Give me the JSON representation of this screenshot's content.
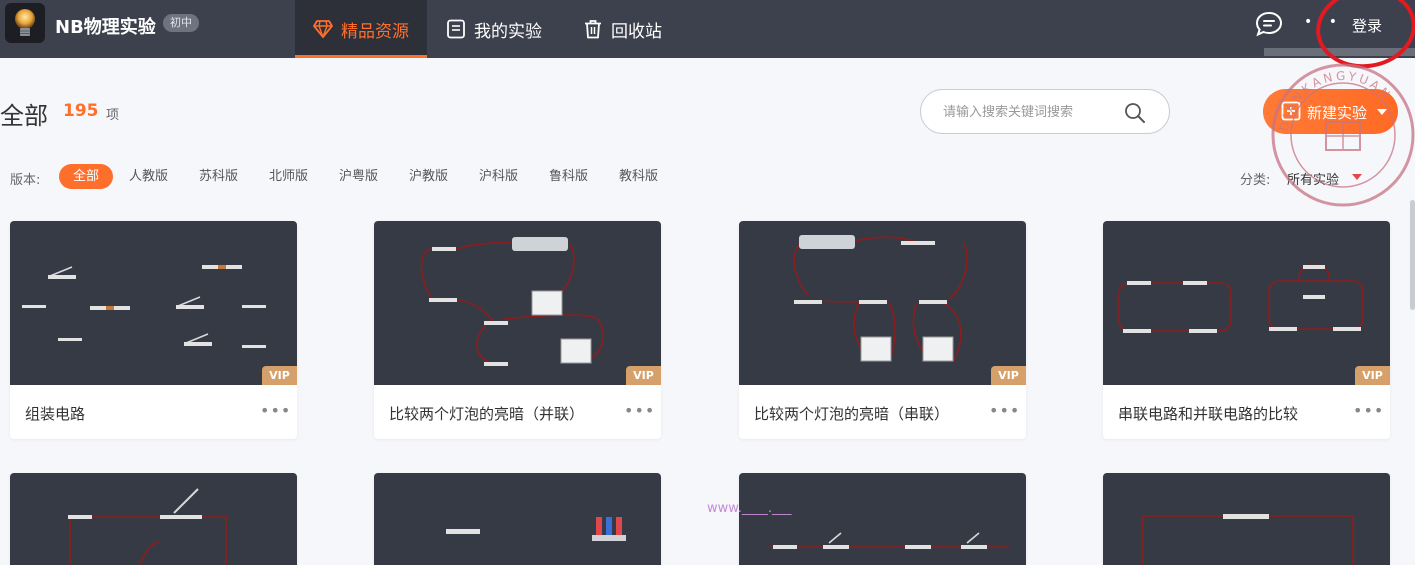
{
  "header": {
    "app_name": "NB物理实验",
    "grade_badge": "初中",
    "tabs": [
      {
        "label": "精品资源",
        "icon": "diamond-icon",
        "active": true
      },
      {
        "label": "我的实验",
        "icon": "notebook-icon",
        "active": false
      },
      {
        "label": "回收站",
        "icon": "trash-icon",
        "active": false
      }
    ],
    "login_label": "登录",
    "more_dots": "• •",
    "accent_color": "#ff6f2c"
  },
  "main": {
    "title": "全部",
    "count": "195",
    "count_unit": "项",
    "search_placeholder": "请输入搜索关键词搜索",
    "new_button_label": "新建实验"
  },
  "filters": {
    "version_label": "版本:",
    "versions": [
      "全部",
      "人教版",
      "苏科版",
      "北师版",
      "沪粤版",
      "沪教版",
      "沪科版",
      "鲁科版",
      "教科版"
    ],
    "active_version": "全部",
    "category_label": "分类:",
    "category_value": "所有实验"
  },
  "cards": [
    {
      "title": "组装电路",
      "badge": "VIP",
      "more": "•••"
    },
    {
      "title": "比较两个灯泡的亮暗（并联）",
      "badge": "VIP",
      "more": "•••"
    },
    {
      "title": "比较两个灯泡的亮暗（串联）",
      "badge": "VIP",
      "more": "•••"
    },
    {
      "title": "串联电路和并联电路的比较",
      "badge": "VIP",
      "more": "•••"
    }
  ],
  "watermark": "www.____.___",
  "stamp_text": "DIANKANGYUAN"
}
